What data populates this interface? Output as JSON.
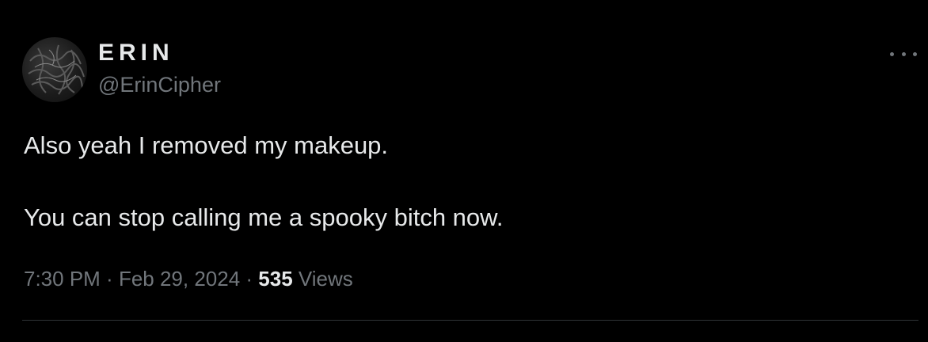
{
  "author": {
    "display_name": "ERIN",
    "handle": "@ErinCipher",
    "avatar_icon": "user-avatar"
  },
  "menu": {
    "icon": "more-horizontal-icon"
  },
  "tweet": {
    "line1": "Also yeah I removed my makeup.",
    "line2": "You can stop calling me a spooky bitch now."
  },
  "meta": {
    "time": "7:30 PM",
    "separator1": " · ",
    "date": "Feb 29, 2024",
    "separator2": " · ",
    "views_count": "535",
    "views_label": " Views"
  },
  "colors": {
    "background": "#000000",
    "text_primary": "#e7e9ea",
    "text_secondary": "#71767b",
    "divider": "#2f3336"
  }
}
